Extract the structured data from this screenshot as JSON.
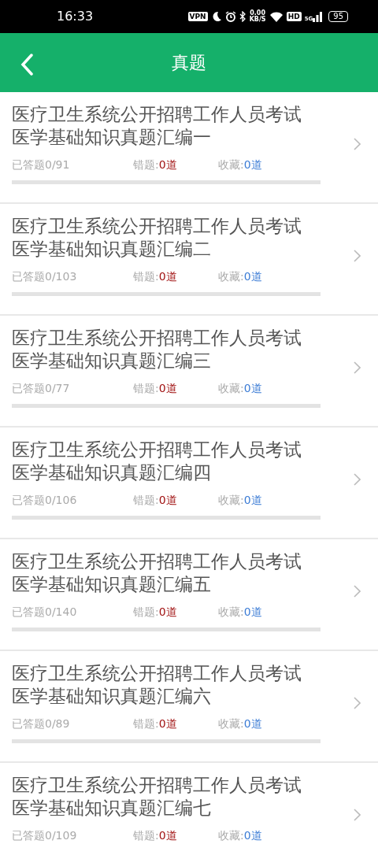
{
  "status_bar": {
    "time": "16:33",
    "vpn": "VPN",
    "speed_value": "0.00",
    "speed_unit": "KB/S",
    "hd": "HD",
    "network": "5G",
    "battery": "95"
  },
  "header": {
    "title": "真题",
    "back": true
  },
  "items": [
    {
      "title": "医疗卫生系统公开招聘工作人员考试医学基础知识真题汇编一",
      "answered_label": "已答题0/91",
      "wrong_label": "错题:",
      "wrong_count": "0道",
      "fav_label": "收藏:",
      "fav_count": "0道",
      "level": 0
    },
    {
      "title": "医疗卫生系统公开招聘工作人员考试医学基础知识真题汇编二",
      "answered_label": "已答题0/103",
      "wrong_label": "错题:",
      "wrong_count": "0道",
      "fav_label": "收藏:",
      "fav_count": "0道",
      "level": 0
    },
    {
      "title": "医疗卫生系统公开招聘工作人员考试医学基础知识真题汇编三",
      "answered_label": "已答题0/77",
      "wrong_label": "错题:",
      "wrong_count": "0道",
      "fav_label": "收藏:",
      "fav_count": "0道",
      "level": 0
    },
    {
      "title": "医疗卫生系统公开招聘工作人员考试医学基础知识真题汇编四",
      "answered_label": "已答题0/106",
      "wrong_label": "错题:",
      "wrong_count": "0道",
      "fav_label": "收藏:",
      "fav_count": "0道",
      "level": 0
    },
    {
      "title": "医疗卫生系统公开招聘工作人员考试医学基础知识真题汇编五",
      "answered_label": "已答题0/140",
      "wrong_label": "错题:",
      "wrong_count": "0道",
      "fav_label": "收藏:",
      "fav_count": "0道",
      "level": 0
    },
    {
      "title": "医疗卫生系统公开招聘工作人员考试医学基础知识真题汇编六",
      "answered_label": "已答题0/89",
      "wrong_label": "错题:",
      "wrong_count": "0道",
      "fav_label": "收藏:",
      "fav_count": "0道",
      "level": 0
    },
    {
      "title": "医疗卫生系统公开招聘工作人员考试医学基础知识真题汇编七",
      "answered_label": "已答题0/109",
      "wrong_label": "错题:",
      "wrong_count": "0道",
      "fav_label": "收藏:",
      "fav_count": "0道"
    }
  ]
}
